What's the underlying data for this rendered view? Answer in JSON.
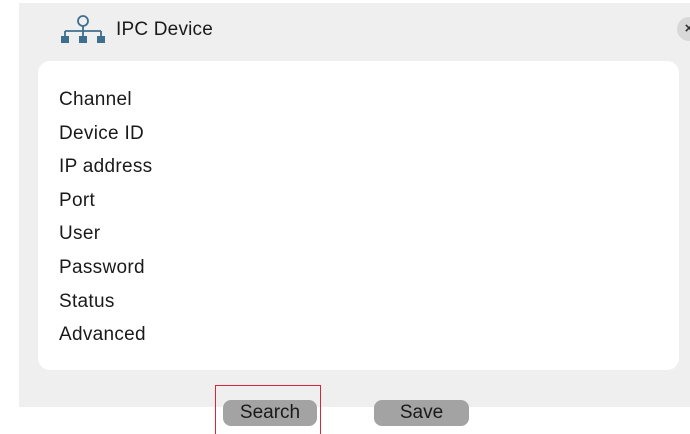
{
  "dialog": {
    "title": "IPC Device",
    "title_icon": "network-icon",
    "close_label": "×"
  },
  "fields": [
    {
      "label": "Channel"
    },
    {
      "label": "Device ID"
    },
    {
      "label": "IP address"
    },
    {
      "label": "Port"
    },
    {
      "label": "User"
    },
    {
      "label": "Password"
    },
    {
      "label": "Status"
    },
    {
      "label": "Advanced"
    }
  ],
  "buttons": {
    "search_label": "Search",
    "save_label": "Save"
  },
  "colors": {
    "dialog_background": "#efefef",
    "panel_background": "#ffffff",
    "button_background": "#a3a3a3",
    "icon_color": "#3f6f8f",
    "highlight_border": "#d4283a"
  }
}
